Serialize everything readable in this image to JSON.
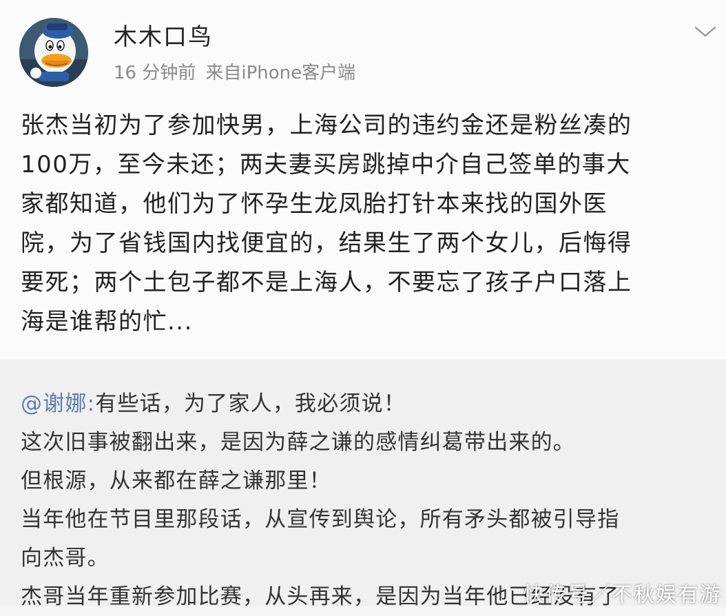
{
  "post": {
    "author": {
      "name": "木木口鸟",
      "avatar_icon": "donald-duck-avatar"
    },
    "time": "16 分钟前",
    "source": "来自iPhone客户端",
    "dropdown_icon": "chevron-down-icon",
    "lines": [
      "张杰当初为了参加快男，上海公司的违约金还是粉丝凑的",
      "100万，至今未还；两夫妻买房跳掉中介自己签单的事大",
      "家都知道，他们为了怀孕生龙凤胎打针本来找的国外医",
      "院，为了省钱国内找便宜的，结果生了两个女儿，后悔得",
      "要死；两个土包子都不是上海人，不要忘了孩子户口落上",
      "海是谁帮的忙..."
    ]
  },
  "repost": {
    "mention": "@谢娜:",
    "first_line_rest": "有些话，为了家人，我必须说！",
    "lines": [
      "这次旧事被翻出来，是因为薛之谦的感情纠葛带出来的。",
      "但根源，从来都在薛之谦那里！",
      "当年他在节目里那段话，从宣传到舆论，所有矛头都被引导指",
      "向杰哥。",
      "杰哥当年重新参加比赛，从头再来，是因为当年他已经没有了"
    ]
  },
  "watermark": "快传号／不秋娱有游",
  "colors": {
    "background": "#fbfbfb",
    "repost_background": "#f0f0f0",
    "mention": "#5b7fae",
    "meta_text": "#8a8a8a"
  }
}
